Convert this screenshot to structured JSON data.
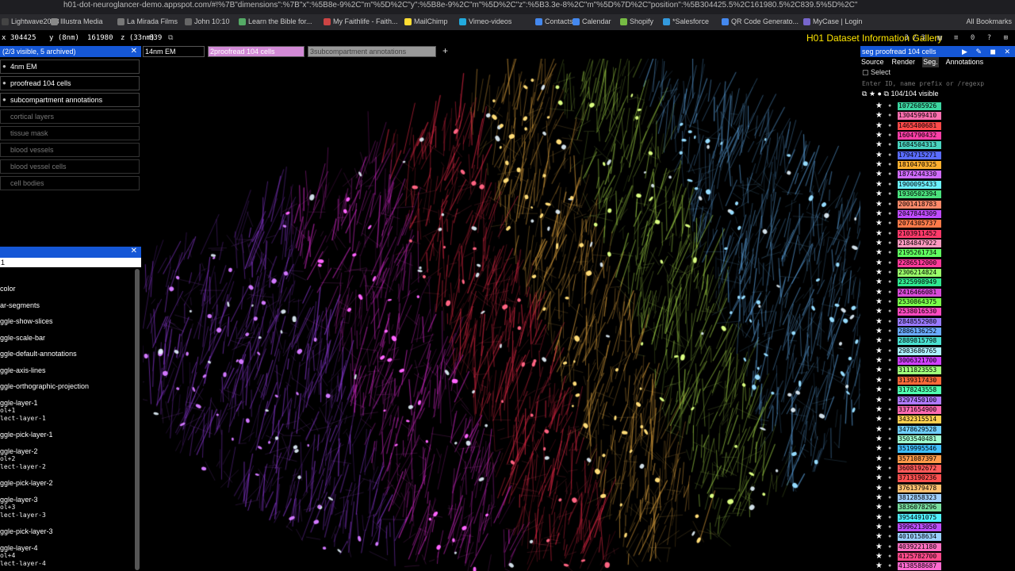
{
  "browser": {
    "url": "h01-dot-neuroglancer-demo.appspot.com/#!%7B\"dimensions\":%7B\"x\":%5B8e-9%2C\"m\"%5D%2C\"y\":%5B8e-9%2C\"m\"%5D%2C\"z\":%5B3.3e-8%2C\"m\"%5D%7D%2C\"position\":%5B304425.5%2C161980.5%2C839.5%5D%2C\"",
    "bookmarks": [
      {
        "label": "Lightwave2018",
        "color": "#444"
      },
      {
        "label": "Illustra Media",
        "color": "#888"
      },
      {
        "label": "La Mirada Films",
        "color": "#777"
      },
      {
        "label": "John 10:10",
        "color": "#666"
      },
      {
        "label": "Learn the Bible for...",
        "color": "#5a6"
      },
      {
        "label": "My Faithlife - Faith...",
        "color": "#c44"
      },
      {
        "label": "MailChimp",
        "color": "#fd3"
      },
      {
        "label": "Vimeo-videos",
        "color": "#2ad"
      },
      {
        "label": "Contacts",
        "color": "#48e"
      },
      {
        "label": "Calendar",
        "color": "#48e"
      },
      {
        "label": "Shopify",
        "color": "#7b4"
      },
      {
        "label": "*Salesforce",
        "color": "#39d"
      },
      {
        "label": "QR Code Generato...",
        "color": "#48e"
      },
      {
        "label": "MyCase | Login",
        "color": "#76c"
      }
    ],
    "all_bookmarks": "All Bookmarks"
  },
  "ngbar": {
    "x_label": "x",
    "x_value": "304425",
    "y_label": "y (8nm)",
    "y_value": "161980",
    "z_label": "z (33nm)",
    "z_value": "839",
    "gallery_title": "H01 Dataset Information Gallery",
    "icons": "3/3 ▤ ≡ 0 ? ⊞"
  },
  "layer_panel": {
    "header": "(2/3 visible, 5 archived)",
    "close": "✕",
    "layers": [
      {
        "label": "4nm EM",
        "dim": false
      },
      {
        "label": "proofread 104 cells",
        "dim": false
      },
      {
        "label": "subcompartment annotations",
        "dim": false
      },
      {
        "label": "cortical layers",
        "dim": true
      },
      {
        "label": "tissue mask",
        "dim": true
      },
      {
        "label": "blood vessels",
        "dim": true
      },
      {
        "label": "blood vessel cells",
        "dim": true
      },
      {
        "label": "cell bodies",
        "dim": true
      }
    ],
    "eye": "●"
  },
  "layer_tabs": [
    {
      "label": "14nm EM",
      "bg": "#000",
      "color": "#fff"
    },
    {
      "label": "2proofread 104 cells",
      "bg": "#d28ad6",
      "color": "#fff"
    },
    {
      "label": "3subcompartment annotations",
      "bg": "#999",
      "color": "#444"
    }
  ],
  "add_tab": "+",
  "key_panel": {
    "close": "✕",
    "sub": "1",
    "entries": [
      {
        "label": "color",
        "keys": []
      },
      {
        "label": "ar-segments",
        "keys": []
      },
      {
        "label": "ggle-show-slices",
        "keys": []
      },
      {
        "label": "ggle-scale-bar",
        "keys": []
      },
      {
        "label": "ggle-default-annotations",
        "keys": []
      },
      {
        "label": "ggle-axis-lines",
        "keys": []
      },
      {
        "label": "ggle-orthographic-projection",
        "keys": []
      },
      {
        "label": "ggle-layer-1",
        "keys": [
          "ol+1",
          "lect-layer-1"
        ]
      },
      {
        "label": "ggle-pick-layer-1",
        "keys": []
      },
      {
        "label": "ggle-layer-2",
        "keys": [
          "ol+2",
          "lect-layer-2"
        ]
      },
      {
        "label": "ggle-pick-layer-2",
        "keys": []
      },
      {
        "label": "ggle-layer-3",
        "keys": [
          "ol+3",
          "lect-layer-3"
        ]
      },
      {
        "label": "ggle-pick-layer-3",
        "keys": []
      },
      {
        "label": "ggle-layer-4",
        "keys": [
          "ol+4",
          "lect-layer-4"
        ]
      }
    ]
  },
  "seg_panel": {
    "header": "seg  proofread 104 cells",
    "header_icons": "▶ ✎ ◼ ✕",
    "tabs": [
      {
        "label": "Source",
        "active": false
      },
      {
        "label": "Render",
        "active": false
      },
      {
        "label": "Seg.",
        "active": true
      },
      {
        "label": "Annotations",
        "active": false
      }
    ],
    "select_label": "Select",
    "filter_placeholder": "Enter ID, name prefix or /regexp",
    "visible_count": "104/104 visible",
    "star": "★",
    "eye": "●",
    "segments": [
      {
        "id": "1072605926",
        "color": "#3cd4a0"
      },
      {
        "id": "1304599410",
        "color": "#ff6fb0"
      },
      {
        "id": "1465400681",
        "color": "#ff4a4a"
      },
      {
        "id": "1604790432",
        "color": "#ff3fa8"
      },
      {
        "id": "1684504313",
        "color": "#4ad4c0"
      },
      {
        "id": "1794715271",
        "color": "#5a6cff"
      },
      {
        "id": "1810470325",
        "color": "#ffb030"
      },
      {
        "id": "1874244330",
        "color": "#d06cff"
      },
      {
        "id": "1900095433",
        "color": "#6cf0ff"
      },
      {
        "id": "1930502394",
        "color": "#4ae07c"
      },
      {
        "id": "2001418783",
        "color": "#ff8a6a"
      },
      {
        "id": "2047844309",
        "color": "#c04cff"
      },
      {
        "id": "2074305737",
        "color": "#ff7a4a"
      },
      {
        "id": "2103911452",
        "color": "#ff3a6a"
      },
      {
        "id": "2184847922",
        "color": "#ff9ac0"
      },
      {
        "id": "2195261734",
        "color": "#60ff60"
      },
      {
        "id": "2286512000",
        "color": "#ff3a9a"
      },
      {
        "id": "2306214824",
        "color": "#9aff6a"
      },
      {
        "id": "2325998949",
        "color": "#30e890"
      },
      {
        "id": "2416466081",
        "color": "#d84ad8"
      },
      {
        "id": "2530864375",
        "color": "#7aff4a"
      },
      {
        "id": "2538016530",
        "color": "#ff4ac0"
      },
      {
        "id": "2848552980",
        "color": "#9a7aff"
      },
      {
        "id": "2886136252",
        "color": "#6aaaff"
      },
      {
        "id": "2889815798",
        "color": "#4ae0d0"
      },
      {
        "id": "2983686765",
        "color": "#aaf0ff"
      },
      {
        "id": "3006321700",
        "color": "#d040ff"
      },
      {
        "id": "3111823553",
        "color": "#a0ff7a"
      },
      {
        "id": "3139317430",
        "color": "#ff6a3a"
      },
      {
        "id": "3178243558",
        "color": "#50ffb0"
      },
      {
        "id": "3297450100",
        "color": "#b07aff"
      },
      {
        "id": "3371654900",
        "color": "#ff6ab0"
      },
      {
        "id": "3432315514",
        "color": "#ffd050"
      },
      {
        "id": "3478629528",
        "color": "#70d0ff"
      },
      {
        "id": "3503540481",
        "color": "#a0ffd0"
      },
      {
        "id": "3519995546",
        "color": "#40c0ff"
      },
      {
        "id": "3571087397",
        "color": "#ff9a4a"
      },
      {
        "id": "3608192672",
        "color": "#ff5a5a"
      },
      {
        "id": "3713190236",
        "color": "#ff5050"
      },
      {
        "id": "3761379478",
        "color": "#ffc070"
      },
      {
        "id": "3812858323",
        "color": "#a0d0ff"
      },
      {
        "id": "3836078296",
        "color": "#7ae0a0"
      },
      {
        "id": "3954491075",
        "color": "#50f0ff"
      },
      {
        "id": "3996213050",
        "color": "#c050ff"
      },
      {
        "id": "4010158634",
        "color": "#9ad0ff"
      },
      {
        "id": "4039221180",
        "color": "#ff70c0"
      },
      {
        "id": "4125782700",
        "color": "#ff4a8a"
      },
      {
        "id": "4138588687",
        "color": "#ff6ad0"
      }
    ]
  }
}
